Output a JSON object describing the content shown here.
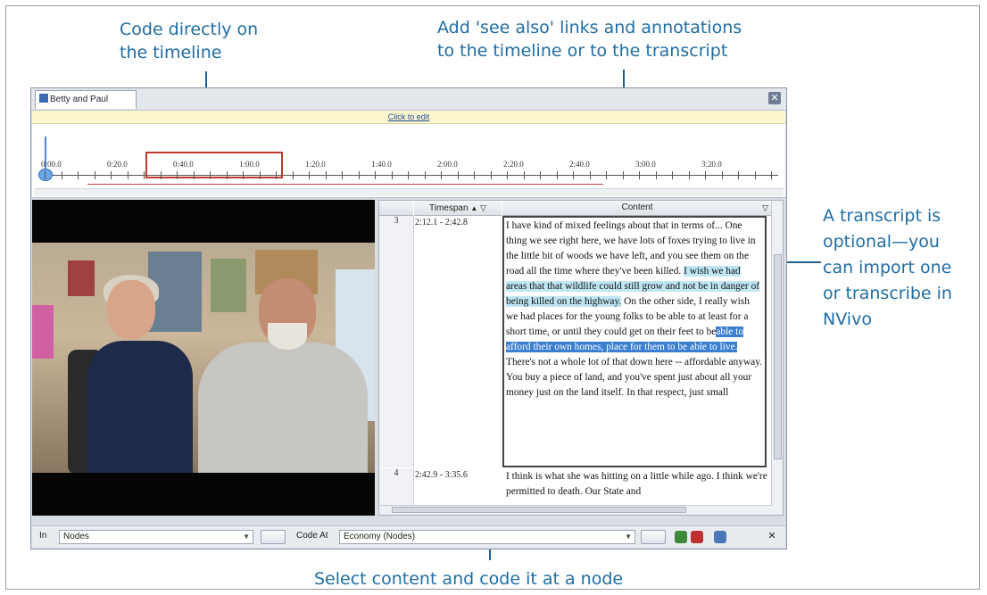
{
  "callouts": {
    "timeline_code": [
      "Code directly on",
      "the timeline"
    ],
    "see_also": [
      "Add 'see also' links and annotations",
      "to the timeline or to the transcript"
    ],
    "transcript_note": [
      "A transcript is",
      "optional—you",
      "can import one",
      "or transcribe in",
      "NVivo"
    ],
    "select_code": "Select content and code it at a node"
  },
  "window": {
    "tab_title": "Betty and Paul",
    "close_icon": "close-icon",
    "edit_link": "Click to edit"
  },
  "timeline": {
    "labels": [
      "0:00.0",
      "0:20.0",
      "0:40.0",
      "1:00.0",
      "1:20.0",
      "1:40.0",
      "2:00.0",
      "2:20.0",
      "2:40.0",
      "3:00.0",
      "3:20.0"
    ]
  },
  "transcript": {
    "col_timespan": "Timespan",
    "col_content": "Content",
    "rows": [
      {
        "num": "3",
        "timespan": "2:12.1 - 2:42.8",
        "text_plain_1": "I have kind of mixed feelings about that in terms of... One thing we see right here, we have lots of foxes trying to live in the little bit of woods we have left, and you see them on the road all the time where they've been killed.",
        "text_hl_1": "I wish we had areas that that wildlife could still grow and not be in danger of being killed on the highway.",
        "text_plain_2": "On the other side, I really wish we had places for the young folks to be able to at least for a short time, or until they could get on their feet to be",
        "text_hl_2": "able to afford their own homes, place for them to be able to live.",
        "text_plain_3": "There's not a whole lot of that down here -- affordable anyway. You buy a piece of land, and you've spent just about all your money just on the land itself. In that respect, just small"
      },
      {
        "num": "4",
        "timespan": "2:42.9 - 3:35.6",
        "text": "I think is what she was hitting on a little while ago. I think we're permitted to death. Our State and"
      }
    ]
  },
  "codebar": {
    "in_label": "In",
    "nodes_value": "Nodes",
    "code_at_label": "Code At",
    "node_value": "Economy (Nodes)"
  }
}
